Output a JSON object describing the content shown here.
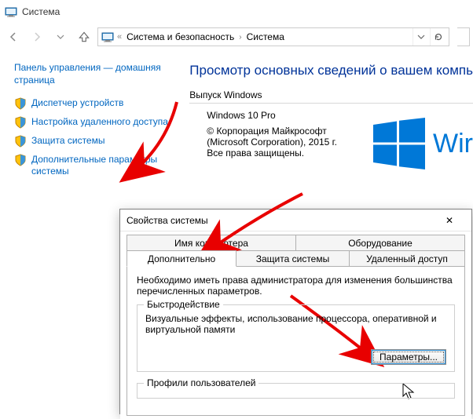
{
  "window": {
    "title": "Система"
  },
  "breadcrumb": {
    "prefix": "«",
    "level1": "Система и безопасность",
    "level2": "Система"
  },
  "sidebar": {
    "home": "Панель управления — домашняя страница",
    "items": [
      {
        "label": "Диспетчер устройств"
      },
      {
        "label": "Настройка удаленного доступа"
      },
      {
        "label": "Защита системы"
      },
      {
        "label": "Дополнительные параметры системы"
      }
    ]
  },
  "main": {
    "heading": "Просмотр основных сведений о вашем компь",
    "edition_group": "Выпуск Windows",
    "edition_value": "Windows 10 Pro",
    "copyright": "© Корпорация Майкрософт (Microsoft Corporation), 2015 г. Все права защищены.",
    "logo_text": "Wir"
  },
  "dialog": {
    "title": "Свойства системы",
    "close": "✕",
    "tabs_top": [
      {
        "label": "Имя компьютера"
      },
      {
        "label": "Оборудование"
      }
    ],
    "tabs_bottom": [
      {
        "label": "Дополнительно",
        "active": true
      },
      {
        "label": "Защита системы"
      },
      {
        "label": "Удаленный доступ"
      }
    ],
    "admin_note": "Необходимо иметь права администратора для изменения большинства перечисленных параметров.",
    "perf": {
      "legend": "Быстродействие",
      "text": "Визуальные эффекты, использование процессора, оперативной и виртуальной памяти",
      "button": "Параметры..."
    },
    "profiles": {
      "legend": "Профили пользователей"
    }
  }
}
